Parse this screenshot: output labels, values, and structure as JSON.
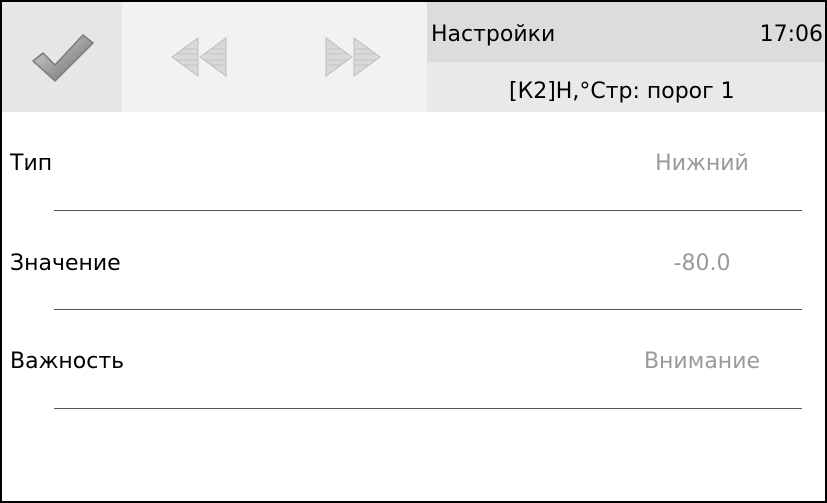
{
  "header": {
    "title": "Настройки",
    "time": "17:06",
    "subtitle": "[К2]Н,°Стр: порог 1"
  },
  "toolbar": {
    "confirm_icon": "checkmark-icon",
    "prev_icon": "double-left-arrow-icon",
    "next_icon": "double-right-arrow-icon"
  },
  "fields": [
    {
      "label": "Тип",
      "value": "Нижний"
    },
    {
      "label": "Значение",
      "value": "-80.0"
    },
    {
      "label": "Важность",
      "value": "Внимание"
    }
  ],
  "colors": {
    "value_text": "#9a9a9a",
    "header_bg": "#dcdcdc",
    "toolbar_bg": "#f2f2f2"
  }
}
